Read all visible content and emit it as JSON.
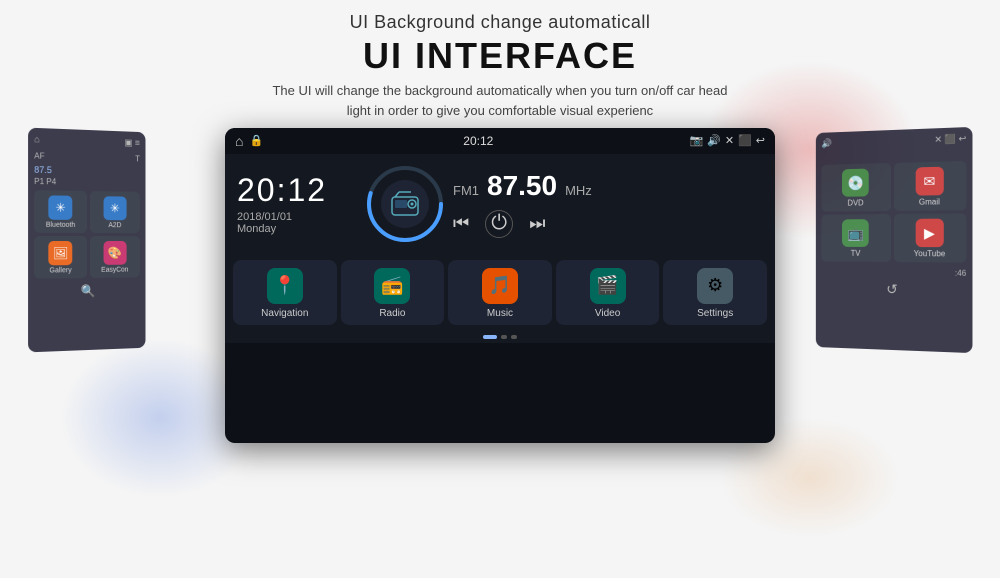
{
  "header": {
    "subtitle": "UI Background change automaticall",
    "title": "UI INTERFACE",
    "desc_line1": "The UI will change the background automatically when you turn on/off car head",
    "desc_line2": "light in order to give you comfortable visual experienc"
  },
  "main_screen": {
    "status_bar": {
      "time": "20:12",
      "icons": [
        "📷",
        "🔊",
        "✕",
        "⬛",
        "↩"
      ]
    },
    "clock": {
      "time": "20:12",
      "date": "2018/01/01",
      "day": "Monday"
    },
    "radio": {
      "label": "FM1",
      "frequency": "87.50",
      "unit": "MHz"
    },
    "apps": [
      {
        "label": "Navigation",
        "icon": "📍",
        "color": "icon-teal"
      },
      {
        "label": "Radio",
        "icon": "📻",
        "color": "icon-teal"
      },
      {
        "label": "Music",
        "icon": "🎵",
        "color": "icon-orange"
      },
      {
        "label": "Video",
        "icon": "🎬",
        "color": "icon-teal"
      },
      {
        "label": "Settings",
        "icon": "⚙",
        "color": "icon-gray"
      }
    ]
  },
  "side_left": {
    "apps": [
      {
        "label": "Bluetooth",
        "icon": "🔷",
        "color": "icon-blue"
      },
      {
        "label": "A2D",
        "icon": "🔷",
        "color": "icon-blue"
      },
      {
        "label": "Gallery",
        "icon": "🖼",
        "color": "icon-orange"
      },
      {
        "label": "EasyCon",
        "icon": "🎨",
        "color": "icon-pink"
      }
    ]
  },
  "side_right": {
    "apps": [
      {
        "label": "DVD",
        "icon": "💿",
        "color": "icon-green"
      },
      {
        "label": "Gmail",
        "icon": "✉",
        "color": "icon-red"
      },
      {
        "label": "TV",
        "icon": "📺",
        "color": "icon-green"
      },
      {
        "label": "YouTube",
        "icon": "▶",
        "color": "icon-red"
      }
    ]
  },
  "colors": {
    "accent": "#8ab4f8",
    "bg_dark": "#0d1117",
    "bg_card": "#1e2433"
  }
}
